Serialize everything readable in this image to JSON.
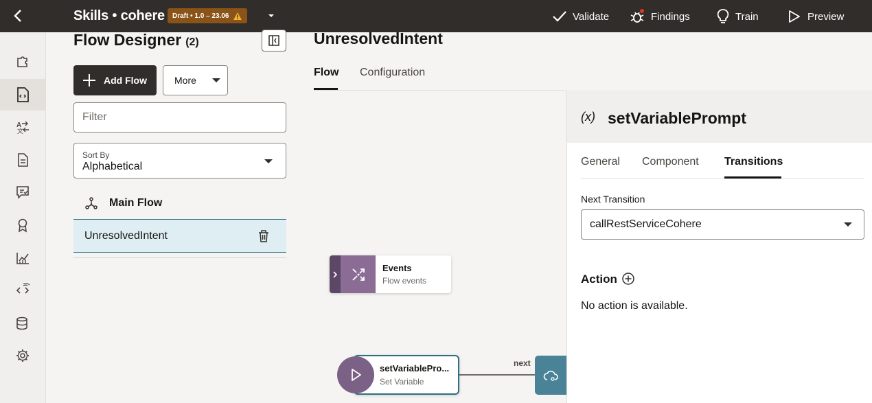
{
  "topbar": {
    "title": "Skills • cohere",
    "badge": "Draft • 1.0 – 23.06",
    "actions": {
      "validate": "Validate",
      "findings": "Findings",
      "train": "Train",
      "preview": "Preview"
    }
  },
  "rail": {
    "icons": [
      "puzzle-icon",
      "flow-document-icon",
      "translate-icon",
      "document-icon",
      "chat-check-icon",
      "award-icon",
      "chart-icon",
      "api-icon",
      "database-icon",
      "gear-icon"
    ],
    "active": "flow-document-icon"
  },
  "flow_designer": {
    "title": "Flow Designer",
    "count": "(2)",
    "add_flow_label": "Add Flow",
    "more_label": "More",
    "filter_placeholder": "Filter",
    "sort_by_label": "Sort By",
    "sort_by_value": "Alphabetical",
    "main_flow_label": "Main Flow",
    "flows": [
      {
        "name": "UnresolvedIntent",
        "selected": true
      }
    ]
  },
  "main": {
    "title": "UnresolvedIntent",
    "tabs": [
      {
        "label": "Flow",
        "active": true
      },
      {
        "label": "Configuration",
        "active": false
      }
    ],
    "canvas": {
      "events_node": {
        "title": "Events",
        "subtitle": "Flow events"
      },
      "setvar_node": {
        "title": "setVariablePro...",
        "subtitle": "Set Variable"
      },
      "connector_label": "next"
    }
  },
  "properties": {
    "icon_text": "(x)",
    "title": "setVariablePrompt",
    "tabs": [
      {
        "label": "General",
        "active": false
      },
      {
        "label": "Component",
        "active": false
      },
      {
        "label": "Transitions",
        "active": true
      }
    ],
    "next_transition_label": "Next Transition",
    "next_transition_value": "callRestServiceCohere",
    "action_label": "Action",
    "no_action_text": "No action is available."
  },
  "colors": {
    "topbar": "#312d2a",
    "badge": "#8a5317",
    "selected_row": "#dfeef3",
    "accent": "#2d6f84",
    "events_node": "#8a6c94"
  }
}
